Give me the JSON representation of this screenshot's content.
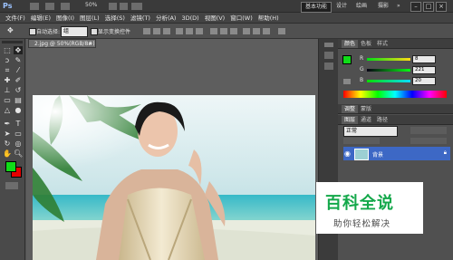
{
  "app": {
    "logo": "Ps",
    "zoom": "50%"
  },
  "workspace": {
    "active": "基本功能",
    "items": [
      "设计",
      "绘画",
      "摄影"
    ],
    "more": "»"
  },
  "window_controls": {
    "minimize": "–",
    "restore": "□",
    "close": "×"
  },
  "menu": [
    "文件(F)",
    "编辑(E)",
    "图像(I)",
    "图层(L)",
    "选择(S)",
    "滤镜(T)",
    "分析(A)",
    "3D(D)",
    "视图(V)",
    "窗口(W)",
    "帮助(H)"
  ],
  "options": {
    "auto_select_label": "自动选择:",
    "auto_select_value": "组",
    "show_transform_label": "显示变换控件"
  },
  "document": {
    "tab_title": "2.jpg @ 50%(RGB/8#)",
    "tab_close": "×"
  },
  "color_panel": {
    "tabs": [
      "颜色",
      "色板",
      "样式"
    ],
    "r_label": "R",
    "r_value": "8",
    "g_label": "G",
    "g_value": "221",
    "b_label": "B",
    "b_value": "20"
  },
  "adjust_panel": {
    "tabs": [
      "调整",
      "蒙版"
    ]
  },
  "layers_panel": {
    "tabs": [
      "图层",
      "通道",
      "路径"
    ],
    "blend_mode": "正常",
    "layer_name": "背景"
  },
  "colors": {
    "foreground": "#10dc18",
    "background": "#e60000",
    "layer_selected": "#3d68c5",
    "watermark_green": "#13a84a"
  },
  "watermark": {
    "title": "百科全说",
    "subtitle": "助你轻松解决"
  }
}
